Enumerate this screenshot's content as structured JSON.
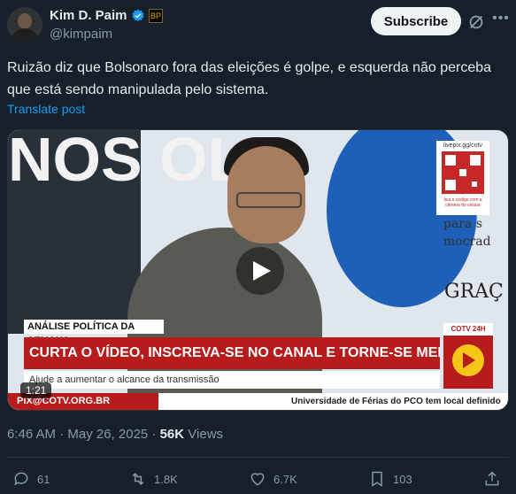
{
  "author": {
    "name": "Kim D. Paim",
    "handle": "@kimpaim",
    "affiliate_badge": "BP"
  },
  "subscribe_label": "Subscribe",
  "post_text": "Ruizão diz que Bolsonaro fora das eleições é golpe, e esquerda não perceba que está sendo manipulada pelo sistema.",
  "translate_label": "Translate post",
  "video": {
    "background_text": "NOS OL",
    "right_wall_text": [
      "para s",
      "mocrad"
    ],
    "right_wall_big": "GRAÇ",
    "qr_url": "livepix.gg/cotv",
    "qr_caption": "leia o código com a câmera do celular",
    "kicker": "ANÁLISE POLÍTICA DA SEMANA",
    "headline": "CURTA O VÍDEO, INSCREVA-SE NO CANAL E TORNE-SE MEMBRO PELO CATARSE",
    "subline": "Ajude a aumentar o alcance da transmissão",
    "pix": "PIX@COTV.ORG.BR",
    "ticker": "Universidade de Férias do PCO tem local definido",
    "channel_label": "COTV 24H",
    "duration": "1:21"
  },
  "meta": {
    "time": "6:46 AM · May 26, 2025 · ",
    "views_count": "56K",
    "views_label": " Views"
  },
  "actions": {
    "replies": "61",
    "reposts": "1.8K",
    "likes": "6.7K",
    "bookmarks": "103"
  },
  "colors": {
    "background": "#15202b",
    "link": "#1d9bf0",
    "muted": "#8b98a5",
    "banner_red": "#b71c1c"
  }
}
